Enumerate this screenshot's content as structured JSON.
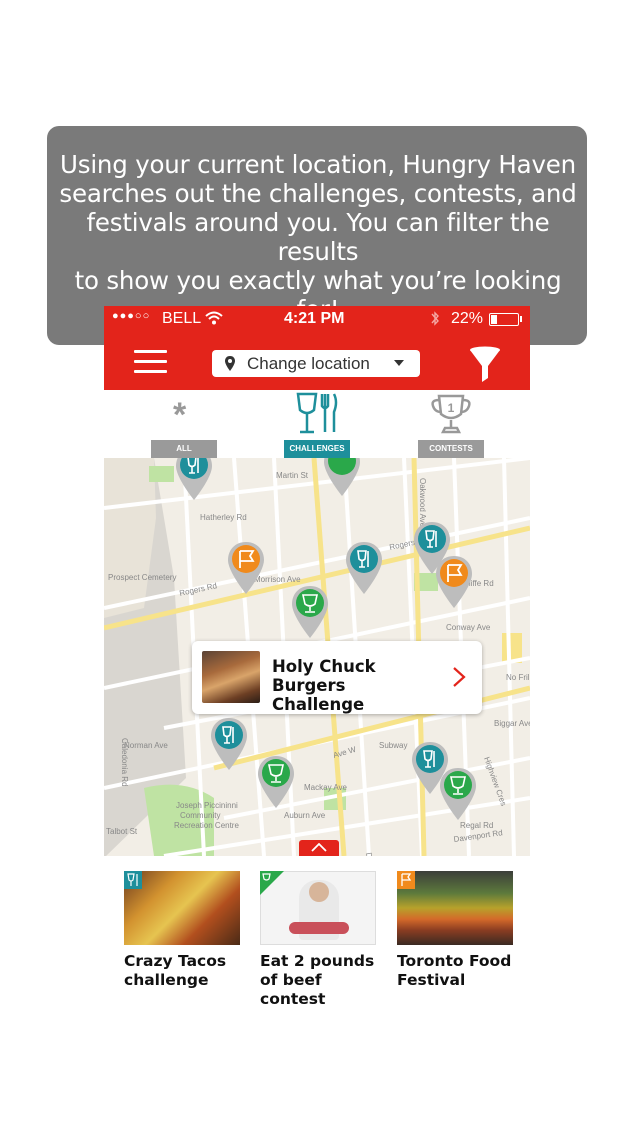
{
  "tooltip": {
    "lines": [
      "Using your current location, Hungry Haven",
      "searches out the challenges, contests, and",
      "festivals around you.  You can filter the results",
      "to show you exactly what you’re looking for!"
    ]
  },
  "status_bar": {
    "carrier": "BELL",
    "time": "4:21 PM",
    "battery": "22%",
    "battery_level": 0.22
  },
  "app_bar": {
    "location_label": "Change location"
  },
  "tabs": [
    {
      "label": "ALL",
      "icon": "asterisk-icon",
      "active": false
    },
    {
      "label": "CHALLENGES",
      "icon": "fork-knife-glass-icon",
      "active": true
    },
    {
      "label": "CONTESTS",
      "icon": "trophy-icon",
      "active": false
    }
  ],
  "map": {
    "street_labels": [
      "Martin St",
      "Rogers Rd",
      "Prospect Cemetery",
      "Rogers Rd",
      "Earnscliffe Rd",
      "Conway Ave",
      "Hatherley Rd",
      "Morrison Ave",
      "Oakwood Ave",
      "Caledonia Rd",
      "Norman Ave",
      "Mackay Ave",
      "Auburn Ave",
      "Subway",
      "No Frills",
      "Regal Rd",
      "Davenport Rd",
      "Joseph Piccininni Community Recreation Centre",
      "Talbot St",
      "Dufferin St",
      "Ave W",
      "Lanark Ave",
      "Jesmond Ave",
      "Northcliffe Blvd",
      "Biggar Ave",
      "Highview Cres"
    ],
    "colors": {
      "challenge": "#1e8f9b",
      "contest": "#2aa84a",
      "festival": "#f08a1c"
    }
  },
  "popup": {
    "title": "Holy Chuck Burgers Challenge"
  },
  "cards": [
    {
      "title_lines": [
        "Crazy Tacos",
        "challenge"
      ],
      "type": "challenge"
    },
    {
      "title_lines": [
        "Eat 2 pounds",
        "of beef contest"
      ],
      "type": "contest"
    },
    {
      "title_lines": [
        "Toronto Food",
        "Festival"
      ],
      "type": "festival"
    }
  ]
}
